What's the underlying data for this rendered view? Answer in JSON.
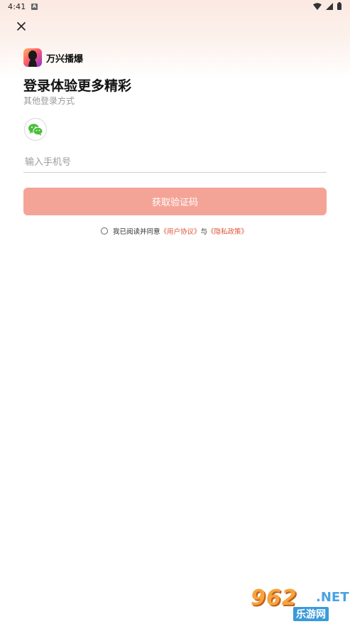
{
  "status_bar": {
    "time": "4:41",
    "badge": "A",
    "icons": [
      "wifi-icon",
      "signal-icon",
      "battery-icon"
    ]
  },
  "header": {
    "close_icon": "close-icon"
  },
  "brand": {
    "name": "万兴播爆",
    "logo_colors": [
      "#ffb35c",
      "#ff5d6c",
      "#8e2fd9"
    ]
  },
  "login": {
    "title": "登录体验更多精彩",
    "subtitle": "其他登录方式",
    "social": [
      {
        "icon": "wechat-icon",
        "color": "#4cbf3a"
      }
    ],
    "phone_placeholder": "输入手机号",
    "get_code_label": "获取验证码",
    "button_color": "#f4a497"
  },
  "agreement": {
    "prefix": "我已阅读并同意",
    "user_agreement": "《用户协议》",
    "connector": "与",
    "privacy_policy": "《隐私政策》",
    "link_color": "#e0533a"
  },
  "watermark": {
    "number": "962",
    "suffix": ".NET",
    "cn": "乐游网"
  }
}
